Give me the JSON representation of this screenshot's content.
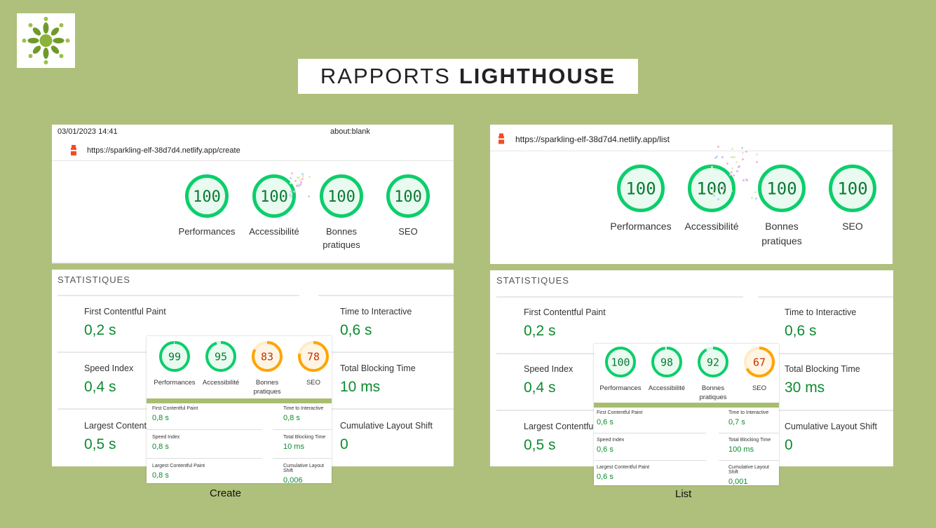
{
  "title": {
    "part1": "RAPPORTS",
    "part2": "LIGHTHOUSE"
  },
  "left": {
    "header": {
      "date": "03/01/2023 14:41",
      "page": "about:blank",
      "url": "https://sparkling-elf-38d7d4.netlify.app/create"
    },
    "gauges": [
      {
        "value": "100",
        "label": "Performances",
        "score": 100
      },
      {
        "value": "100",
        "label": "Accessibilité",
        "score": 100
      },
      {
        "value": "100",
        "label": "Bonnes pratiques",
        "score": 100
      },
      {
        "value": "100",
        "label": "SEO",
        "score": 100
      }
    ],
    "stats_title": "STATISTIQUES",
    "metrics": {
      "fcp": {
        "name": "First Contentful Paint",
        "value": "0,2 s"
      },
      "tti": {
        "name": "Time to Interactive",
        "value": "0,6 s"
      },
      "si": {
        "name": "Speed Index",
        "value": "0,4 s"
      },
      "tbt": {
        "name": "Total Blocking Time",
        "value": "10 ms"
      },
      "lcp": {
        "name": "Largest Contentful Paint",
        "value": "0,5 s"
      },
      "cls": {
        "name": "Cumulative Layout Shift",
        "value": "0"
      }
    },
    "overlay": {
      "gauges": [
        {
          "value": "99",
          "label": "Performances",
          "score": 99,
          "color": "#0cce6b"
        },
        {
          "value": "95",
          "label": "Accessibilité",
          "score": 95,
          "color": "#0cce6b"
        },
        {
          "value": "83",
          "label": "Bonnes pratiques",
          "score": 83,
          "color": "#ffa400"
        },
        {
          "value": "78",
          "label": "SEO",
          "score": 78,
          "color": "#ffa400"
        }
      ],
      "metrics": {
        "fcp": {
          "name": "First Contentful Paint",
          "value": "0,8 s"
        },
        "tti": {
          "name": "Time to Interactive",
          "value": "0,8 s"
        },
        "si": {
          "name": "Speed Index",
          "value": "0,8 s"
        },
        "tbt": {
          "name": "Total Blocking Time",
          "value": "10 ms"
        },
        "lcp": {
          "name": "Largest Contentful Paint",
          "value": "0,8 s"
        },
        "cls": {
          "name": "Cumulative Layout Shift",
          "value": "0,006"
        }
      }
    },
    "caption": "Create"
  },
  "right": {
    "header": {
      "url": "https://sparkling-elf-38d7d4.netlify.app/list"
    },
    "gauges": [
      {
        "value": "100",
        "label": "Performances",
        "score": 100
      },
      {
        "value": "100",
        "label": "Accessibilité",
        "score": 100
      },
      {
        "value": "100",
        "label": "Bonnes pratiques",
        "score": 100
      },
      {
        "value": "100",
        "label": "SEO",
        "score": 100
      }
    ],
    "stats_title": "STATISTIQUES",
    "metrics": {
      "fcp": {
        "name": "First Contentful Paint",
        "value": "0,2 s"
      },
      "tti": {
        "name": "Time to Interactive",
        "value": "0,6 s"
      },
      "si": {
        "name": "Speed Index",
        "value": "0,4 s"
      },
      "tbt": {
        "name": "Total Blocking Time",
        "value": "30 ms"
      },
      "lcp": {
        "name": "Largest Contentful Paint",
        "value": "0,5 s"
      },
      "cls": {
        "name": "Cumulative Layout Shift",
        "value": "0"
      }
    },
    "overlay": {
      "gauges": [
        {
          "value": "100",
          "label": "Performances",
          "score": 100,
          "color": "#0cce6b"
        },
        {
          "value": "98",
          "label": "Accessibilité",
          "score": 98,
          "color": "#0cce6b"
        },
        {
          "value": "92",
          "label": "Bonnes pratiques",
          "score": 92,
          "color": "#0cce6b"
        },
        {
          "value": "67",
          "label": "SEO",
          "score": 67,
          "color": "#ffa400"
        }
      ],
      "metrics": {
        "fcp": {
          "name": "First Contentful Paint",
          "value": "0,6 s"
        },
        "tti": {
          "name": "Time to Interactive",
          "value": "0,7 s"
        },
        "si": {
          "name": "Speed Index",
          "value": "0,6 s"
        },
        "tbt": {
          "name": "Total Blocking Time",
          "value": "100 ms"
        },
        "lcp": {
          "name": "Largest Contentful Paint",
          "value": "0,6 s"
        },
        "cls": {
          "name": "Cumulative Layout Shift",
          "value": "0,001"
        }
      }
    },
    "caption": "List"
  },
  "colors": {
    "good": "#0cce6b",
    "average": "#ffa400",
    "metric_text": "#0c8a2e",
    "background": "#afc07c"
  },
  "icons": {
    "logo": "green-flower-logo",
    "lighthouse": "lighthouse-icon"
  }
}
